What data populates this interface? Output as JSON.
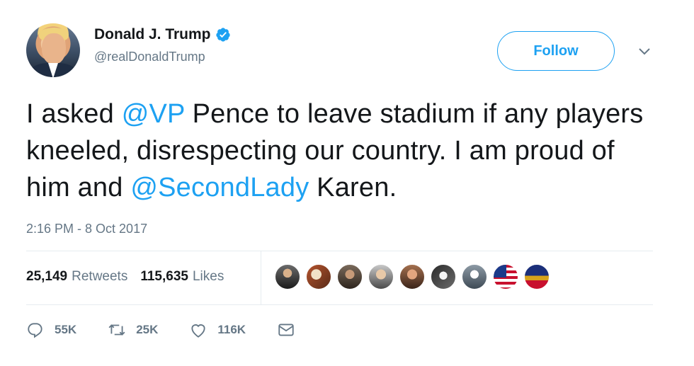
{
  "author": {
    "display_name": "Donald J. Trump",
    "handle": "@realDonaldTrump",
    "verified": true
  },
  "follow_label": "Follow",
  "tweet": {
    "segments": [
      {
        "text": "I asked ",
        "type": "text"
      },
      {
        "text": "@VP",
        "type": "mention"
      },
      {
        "text": " Pence to leave stadium if any players kneeled, disrespecting our country. I am proud of him and ",
        "type": "text"
      },
      {
        "text": "@SecondLady",
        "type": "mention"
      },
      {
        "text": " Karen.",
        "type": "text"
      }
    ],
    "timestamp": "2:16 PM - 8 Oct 2017"
  },
  "stats": {
    "retweets_count": "25,149",
    "retweets_label": "Retweets",
    "likes_count": "115,635",
    "likes_label": "Likes"
  },
  "actions": {
    "reply_count": "55K",
    "retweet_count": "25K",
    "like_count": "116K"
  },
  "colors": {
    "accent": "#1da1f2",
    "muted": "#657786",
    "text": "#14171a",
    "divider": "#e6ecf0"
  },
  "icons": [
    "verified-badge-icon",
    "chevron-down-icon",
    "reply-icon",
    "retweet-icon",
    "like-icon",
    "direct-message-icon"
  ]
}
